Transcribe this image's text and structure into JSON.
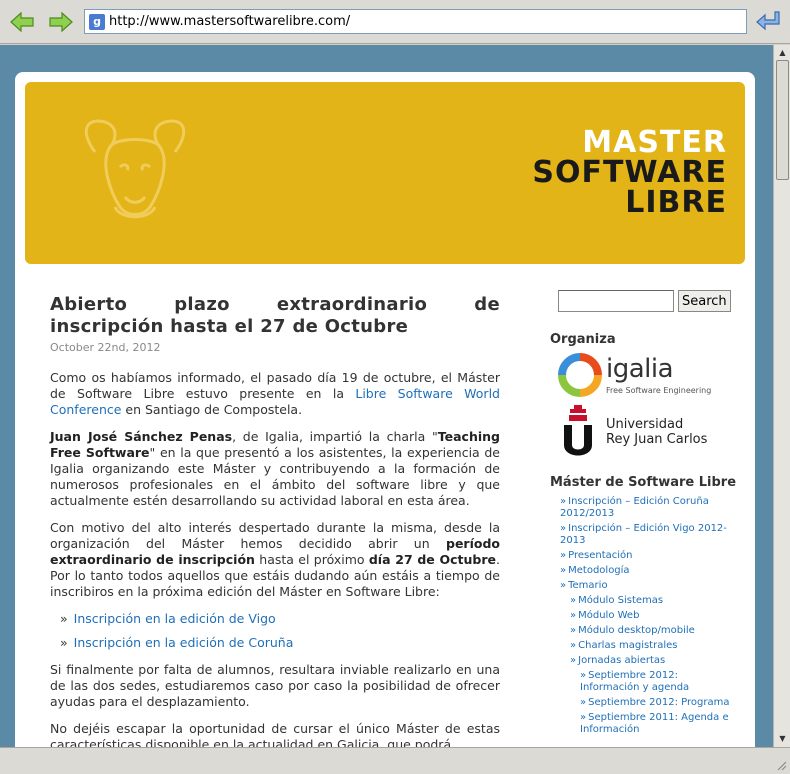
{
  "browser": {
    "url": "http://www.mastersoftwarelibre.com/",
    "favicon_letter": "g"
  },
  "site": {
    "title_line1": "MASTER",
    "title_line2": "SOFTWARE",
    "title_line3": "LIBRE"
  },
  "post": {
    "title_words": [
      "Abierto",
      "plazo",
      "extraordinario",
      "de"
    ],
    "title_line2": "inscripción hasta el 27 de Octubre",
    "date": "October 22nd, 2012",
    "p1_a": "Como os habíamos informado, el pasado día 19 de octubre, el Máster de Software Libre estuvo presente en la ",
    "p1_link": "Libre Software World Conference",
    "p1_b": " en Santiago de Compostela.",
    "p2_name": "Juan José Sánchez Penas",
    "p2_a": ", de Igalia, impartió la charla \"",
    "p2_talk": "Teaching Free Software",
    "p2_b": "\" en la que presentó a los asistentes, la experiencia de Igalia organizando este Máster y contribuyendo a la formación de numerosos profesionales en el ámbito del software libre y que actualmente estén desarrollando su actividad laboral en esta área.",
    "p3_a": "Con motivo del alto interés despertado durante la misma, desde la organización del Máster hemos decidido abrir un ",
    "p3_bold1": "período extraordinario de inscripción",
    "p3_b": " hasta el próximo ",
    "p3_bold2": "día 27 de Octubre",
    "p3_c": ". Por lo tanto todos aquellos que estáis dudando aún estáis a tiempo de inscribiros en la próxima edición del Máster en Software Libre:",
    "links": [
      "Inscripción en la edición de Vigo",
      "Inscripción en la edición de Coruña"
    ],
    "p4": "Si finalmente por falta de alumnos, resultara inviable realizarlo en una de las dos sedes, estudiaremos caso por caso la posibilidad de ofrecer ayudas para el desplazamiento.",
    "p5": "No dejéis escapar la oportunidad de cursar el único Máster de estas características disponible en la actualidad en Galicia, que podrá"
  },
  "sidebar": {
    "search_button": "Search",
    "search_value": "",
    "organiza_heading": "Organiza",
    "igalia_name": "igalia",
    "igalia_tagline": "Free Software Engineering",
    "urjc_line1": "Universidad",
    "urjc_line2": "Rey Juan Carlos",
    "menu_heading": "Máster de Software Libre",
    "menu": [
      {
        "label": "Inscripción – Edición Coruña 2012/2013",
        "level": 1
      },
      {
        "label": "Inscripción – Edición Vigo 2012-2013",
        "level": 1
      },
      {
        "label": "Presentación",
        "level": 1
      },
      {
        "label": "Metodología",
        "level": 1
      },
      {
        "label": "Temario",
        "level": 1
      },
      {
        "label": "Módulo Sistemas",
        "level": 2
      },
      {
        "label": "Módulo Web",
        "level": 2
      },
      {
        "label": "Módulo desktop/mobile",
        "level": 2
      },
      {
        "label": "Charlas magistrales",
        "level": 2
      },
      {
        "label": "Jornadas abiertas",
        "level": 2
      },
      {
        "label": "Septiembre 2012: Información y agenda",
        "level": 3
      },
      {
        "label": "Septiembre 2012: Programa",
        "level": 3
      },
      {
        "label": "Septiembre 2011: Agenda e Información",
        "level": 3
      }
    ]
  },
  "colors": {
    "banner": "#e2b418",
    "page_bg": "#5b8aa6",
    "link": "#1f6fb8"
  }
}
